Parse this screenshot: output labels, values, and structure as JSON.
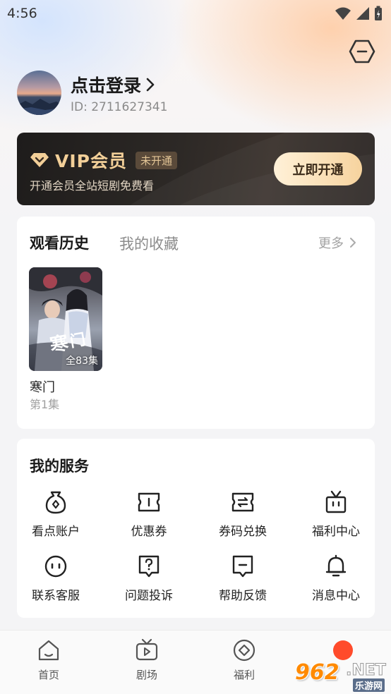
{
  "status_bar": {
    "time": "4:56"
  },
  "profile": {
    "login_label": "点击登录",
    "user_id": "ID: 2711627341"
  },
  "vip": {
    "title": "VIP会员",
    "badge": "未开通",
    "subtitle": "开通会员全站短剧免费看",
    "button": "立即开通",
    "accent_color": "#f2cf98"
  },
  "history": {
    "tab_active": "观看历史",
    "tab_inactive": "我的收藏",
    "more": "更多",
    "items": [
      {
        "poster_text": "寒门",
        "episode_count": "全83集",
        "title": "寒门",
        "progress": "第1集"
      }
    ]
  },
  "services": {
    "title": "我的服务",
    "items": [
      {
        "label": "看点账户",
        "icon": "wallet-icon"
      },
      {
        "label": "优惠券",
        "icon": "coupon-icon"
      },
      {
        "label": "券码兑换",
        "icon": "exchange-icon"
      },
      {
        "label": "福利中心",
        "icon": "gift-icon"
      },
      {
        "label": "联系客服",
        "icon": "chat-icon"
      },
      {
        "label": "问题投诉",
        "icon": "complaint-icon"
      },
      {
        "label": "帮助反馈",
        "icon": "feedback-icon"
      },
      {
        "label": "消息中心",
        "icon": "bell-icon"
      }
    ]
  },
  "bottom_nav": {
    "items": [
      {
        "label": "首页",
        "icon": "home-icon"
      },
      {
        "label": "剧场",
        "icon": "tv-icon"
      },
      {
        "label": "福利",
        "icon": "coin-icon"
      },
      {
        "label": "",
        "icon": "me-icon"
      }
    ]
  },
  "watermark": {
    "logo": "962",
    "suffix": ".NET",
    "sub": "乐游网"
  }
}
